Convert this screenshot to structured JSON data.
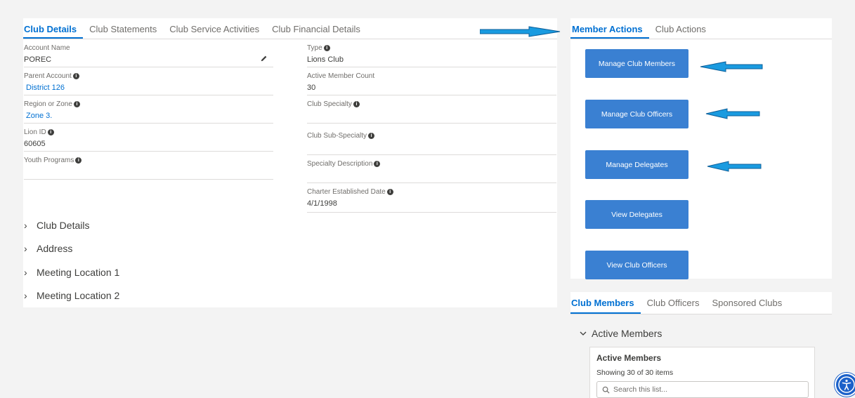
{
  "main_tabs": [
    "Club Details",
    "Club Statements",
    "Club Service Activities",
    "Club Financial Details"
  ],
  "fields_left": [
    {
      "label": "Account Name",
      "value": "POREC",
      "info": false,
      "link": false
    },
    {
      "label": "Parent Account",
      "value": "District 126",
      "info": true,
      "link": true
    },
    {
      "label": "Region or Zone",
      "value": "Zone 3.",
      "info": true,
      "link": true
    },
    {
      "label": "Lion ID",
      "value": "60605",
      "info": true,
      "link": false
    },
    {
      "label": "Youth Programs",
      "value": "",
      "info": true,
      "link": false
    }
  ],
  "fields_right": [
    {
      "label": "Type",
      "value": "Lions Club",
      "info": true
    },
    {
      "label": "Active Member Count",
      "value": "30",
      "info": false
    },
    {
      "label": "Club Specialty",
      "value": "",
      "info": true
    },
    {
      "label": "Club Sub-Specialty",
      "value": "",
      "info": true
    },
    {
      "label": "Specialty Description",
      "value": "",
      "info": true
    },
    {
      "label": "Charter Established Date",
      "value": "4/1/1998",
      "info": true
    }
  ],
  "sections": [
    "Club Details",
    "Address",
    "Meeting Location 1",
    "Meeting Location 2"
  ],
  "action_tabs": [
    "Member Actions",
    "Club Actions"
  ],
  "action_buttons": [
    "Manage Club Members",
    "Manage Club Officers",
    "Manage Delegates",
    "View Delegates",
    "View Club Officers"
  ],
  "member_tabs": [
    "Club Members",
    "Club Officers",
    "Sponsored Clubs"
  ],
  "active_members": {
    "toggle_label": "Active Members",
    "card_title": "Active Members",
    "showing": "Showing 30 of 30 items",
    "search_placeholder": "Search this list..."
  },
  "colors": {
    "accent": "#0070d2",
    "button": "#3a80d2",
    "arrow": "#1a9be0"
  },
  "icons": {
    "edit": "pencil-icon",
    "info": "info-icon",
    "section": "chevron-right-icon",
    "toggle": "chevron-down-icon",
    "search": "search-icon",
    "accessibility": "accessibility-icon"
  }
}
